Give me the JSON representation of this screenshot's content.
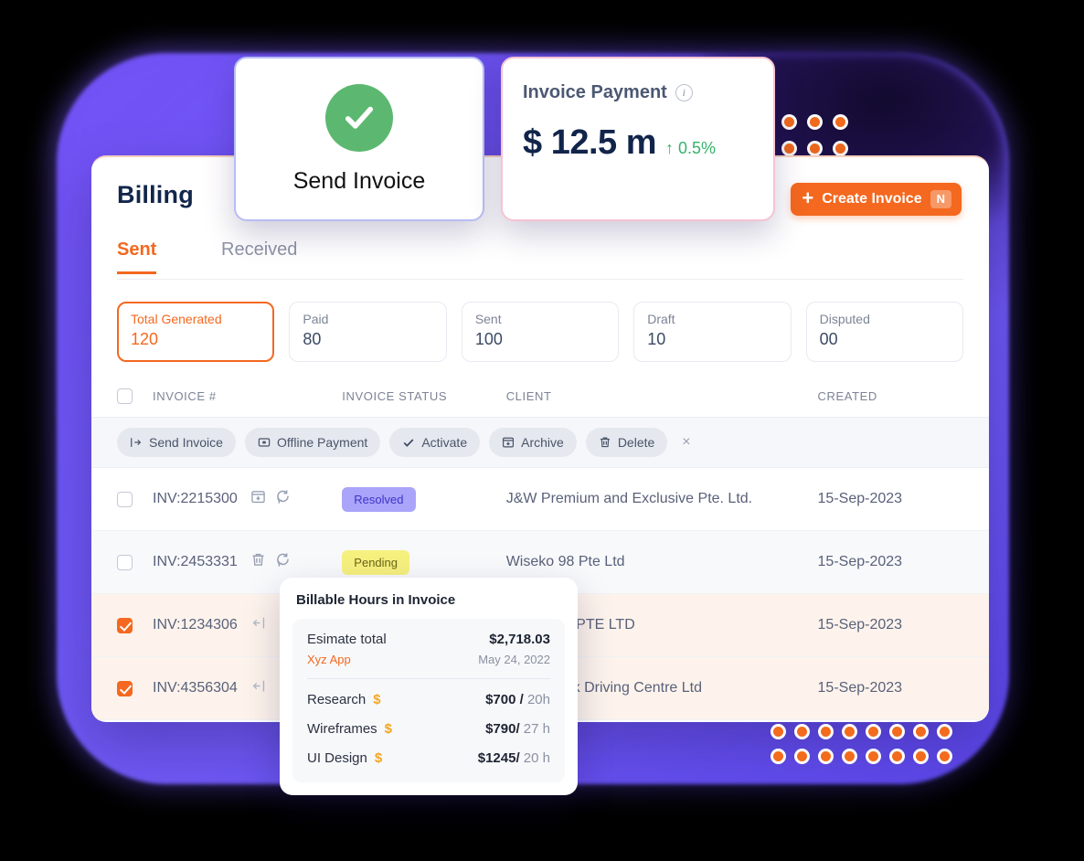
{
  "header": {
    "title": "Billing",
    "create_button": {
      "label": "Create Invoice",
      "plus": "+",
      "shortcut": "N"
    }
  },
  "tabs": [
    {
      "id": "sent",
      "label": "Sent",
      "active": true
    },
    {
      "id": "received",
      "label": "Received",
      "active": false
    }
  ],
  "stats": [
    {
      "label": "Total Generated",
      "value": "120",
      "selected": true
    },
    {
      "label": "Paid",
      "value": "80",
      "selected": false
    },
    {
      "label": "Sent",
      "value": "100",
      "selected": false
    },
    {
      "label": "Draft",
      "value": "10",
      "selected": false
    },
    {
      "label": "Disputed",
      "value": "00",
      "selected": false
    }
  ],
  "table": {
    "columns": [
      "INVOICE #",
      "INVOICE STATUS",
      "CLIENT",
      "CREATED"
    ],
    "toolbar": {
      "actions": [
        {
          "label": "Send Invoice",
          "icon": "send-icon"
        },
        {
          "label": "Offline Payment",
          "icon": "offline-payment-icon"
        },
        {
          "label": "Activate",
          "icon": "check-icon"
        },
        {
          "label": "Archive",
          "icon": "archive-icon"
        },
        {
          "label": "Delete",
          "icon": "trash-icon"
        }
      ],
      "close": "×"
    },
    "rows": [
      {
        "invoice": "INV:2215300",
        "status": "Resolved",
        "status_type": "resolved",
        "client": "J&W Premium and Exclusive Pte. Ltd.",
        "created": "15-Sep-2023",
        "checked": false,
        "icons": [
          "archive-icon",
          "refresh-icon"
        ]
      },
      {
        "invoice": "INV:2453331",
        "status": "Pending",
        "status_type": "pending",
        "client": "Wiseko 98 Pte Ltd",
        "created": "15-Sep-2023",
        "checked": false,
        "icons": [
          "trash-icon",
          "refresh-icon"
        ]
      },
      {
        "invoice": "INV:1234306",
        "status": "",
        "status_type": "none",
        "client": "ONE E&C PTE LTD",
        "created": "15-Sep-2023",
        "checked": true,
        "icons": [
          "send-icon"
        ]
      },
      {
        "invoice": "INV:4356304",
        "status": "",
        "status_type": "none",
        "client": "Bukit Batok Driving Centre Ltd",
        "created": "15-Sep-2023",
        "checked": true,
        "icons": [
          "send-icon"
        ]
      }
    ]
  },
  "send_invoice_card": {
    "caption": "Send Invoice",
    "icon": "check-circle-icon"
  },
  "invoice_payment_card": {
    "title": "Invoice Payment",
    "info_icon": "info-icon",
    "value": "$ 12.5 m",
    "delta": "↑ 0.5%"
  },
  "billable_tooltip": {
    "title": "Billable Hours in Invoice",
    "estimate_label": "Esimate total",
    "estimate_value": "$2,718.03",
    "project": "Xyz App",
    "date": "May 24, 2022",
    "items": [
      {
        "name": "Research",
        "amount": "$700 /",
        "hours": "20h"
      },
      {
        "name": "Wireframes",
        "amount": "$790/",
        "hours": "27 h"
      },
      {
        "name": "UI Design",
        "amount": "$1245/",
        "hours": "20 h"
      }
    ]
  },
  "colors": {
    "accent": "#f4681f",
    "purple_backdrop": "#6a55f2",
    "success_green": "#5cb870",
    "resolved_badge": "#aaa4fa",
    "pending_badge": "#f6f07f",
    "title_navy": "#12264b"
  }
}
